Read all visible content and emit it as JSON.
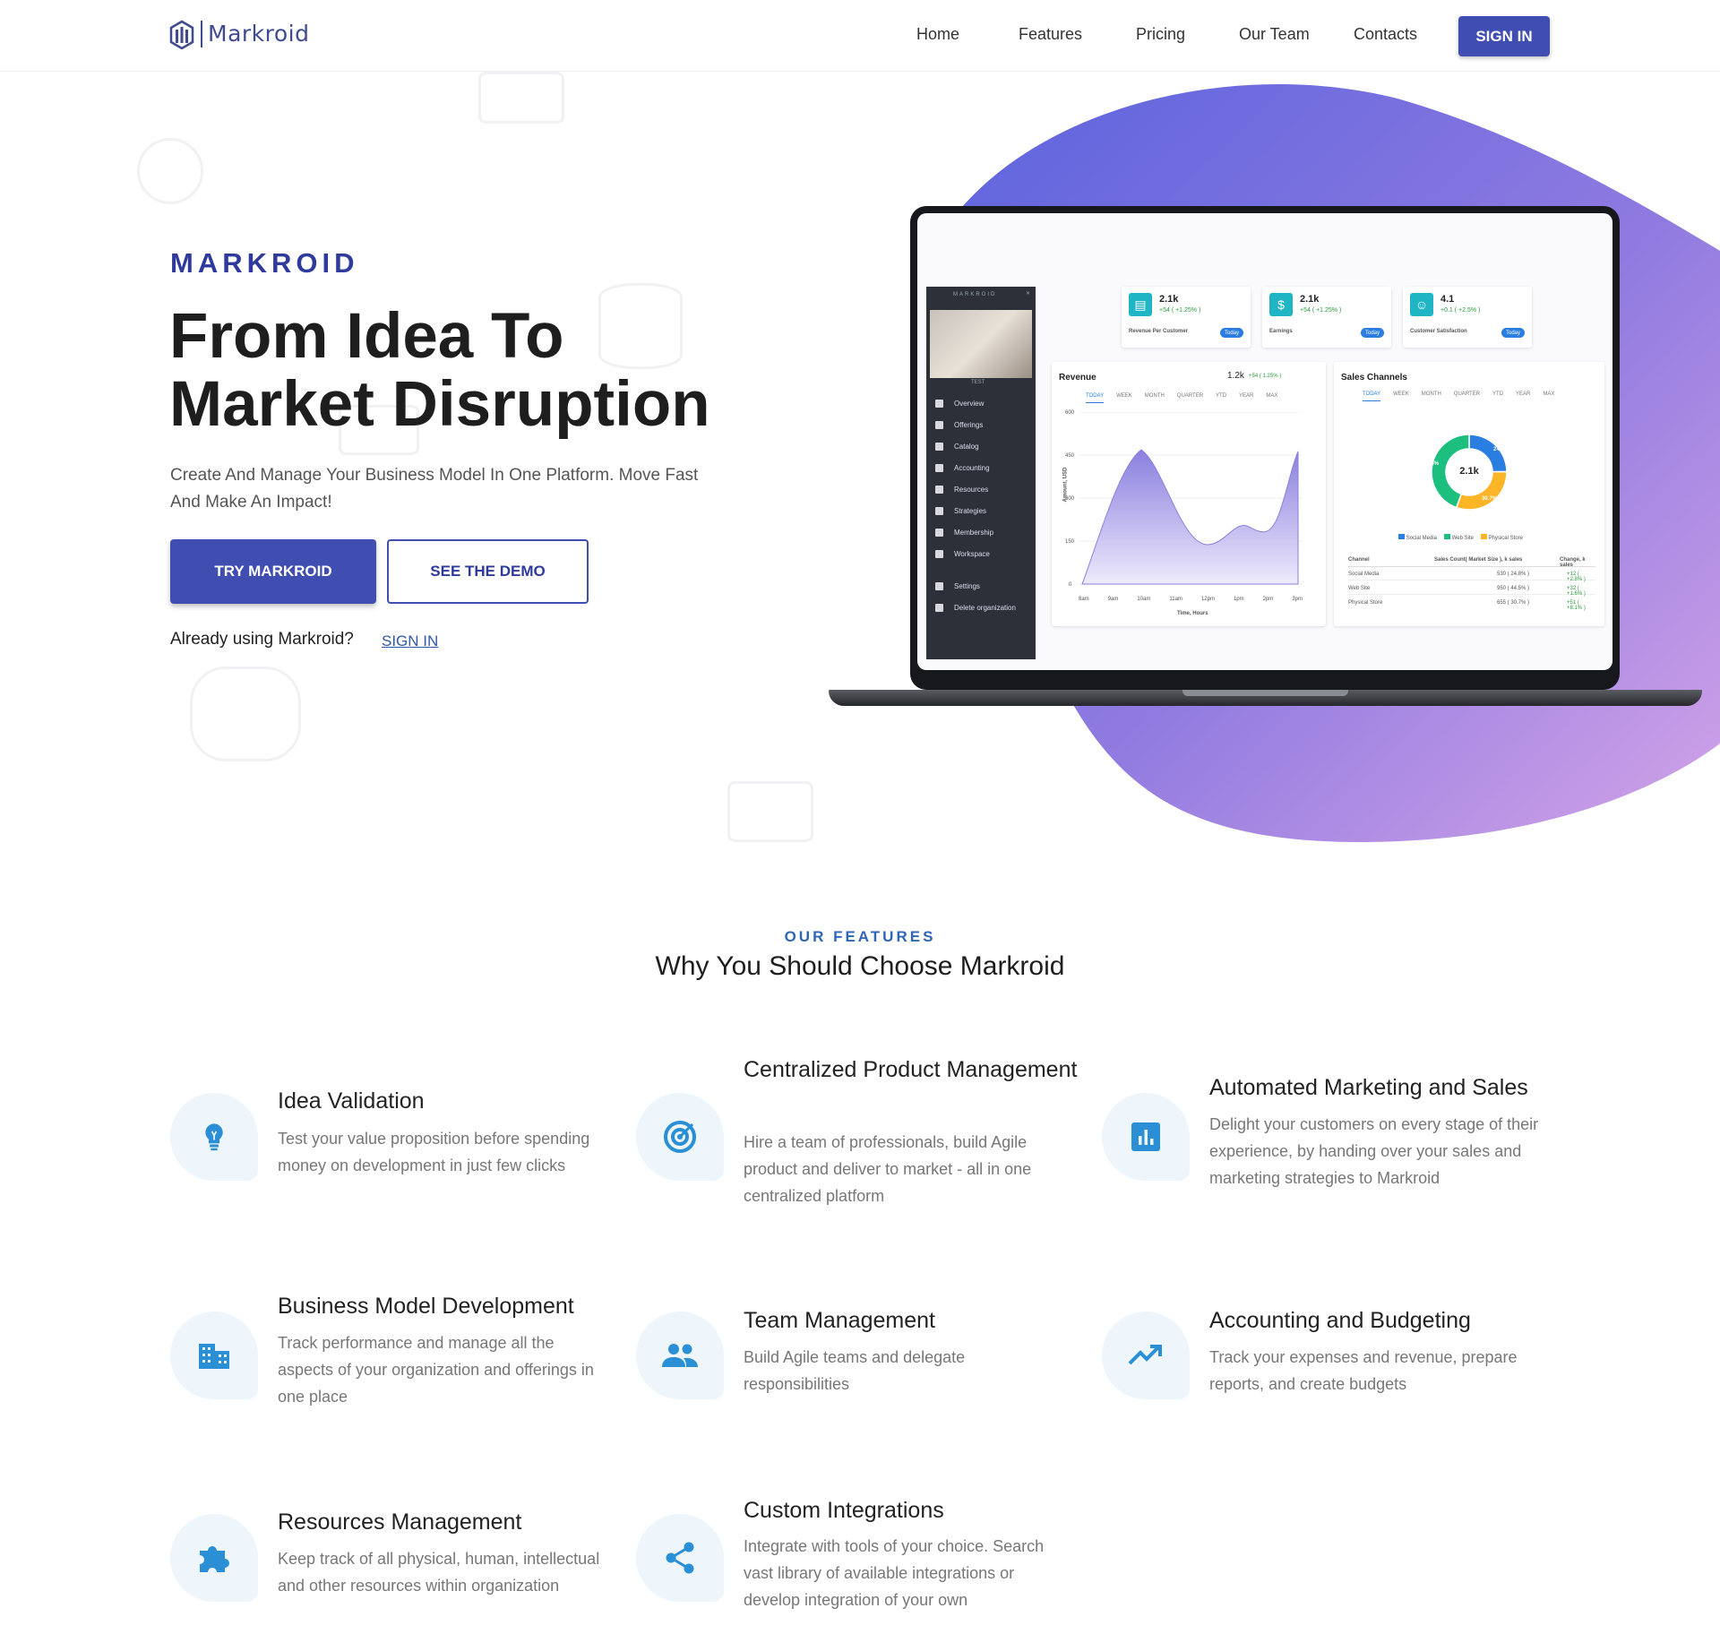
{
  "nav": {
    "logo_text": "Markroid",
    "links": [
      "Home",
      "Features",
      "Pricing",
      "Our Team",
      "Contacts"
    ],
    "signin": "SIGN IN"
  },
  "hero": {
    "brand": "MARKROID",
    "title_line1": "From Idea To",
    "title_line2": "Market Disruption",
    "subtitle": "Create And Manage Your Business Model In One Platform. Move Fast And Make An Impact!",
    "try_button": "TRY MARKROID",
    "demo_button": "SEE THE DEMO",
    "already": "Already using Markroid?",
    "already_link": "SIGN IN"
  },
  "dashboard": {
    "sidebar_brand": "MARKROID",
    "sidebar_user": "TEST",
    "sidebar_items": [
      "Overview",
      "Offerings",
      "Catalog",
      "Accounting",
      "Resources",
      "Strategies",
      "Membership",
      "Workspace",
      "Settings",
      "Delete organization"
    ],
    "kpis": [
      {
        "value": "2.1k",
        "change": "+54 ( +1.25% )",
        "label": "Revenue Per Customer",
        "pill": "Today"
      },
      {
        "value": "2.1k",
        "change": "+54 ( +1.25% )",
        "label": "Earnings",
        "pill": "Today"
      },
      {
        "value": "4.1",
        "change": "+0.1 ( +2.5% )",
        "label": "Customer Satisfaction",
        "pill": "Today"
      }
    ],
    "revenue": {
      "title": "Revenue",
      "value": "1.2k",
      "change": "+54 ( 1.25% )",
      "tabs": [
        "TODAY",
        "WEEK",
        "MONTH",
        "QUARTER",
        "YTD",
        "YEAR",
        "MAX"
      ],
      "ylabel": "Amount, USD",
      "xlabel": "Time, Hours",
      "yticks": [
        "600",
        "450",
        "300",
        "150",
        "0"
      ],
      "xticks": [
        "8am",
        "9am",
        "10am",
        "11am",
        "12pm",
        "1pm",
        "2pm",
        "3pm"
      ]
    },
    "sales": {
      "title": "Sales Channels",
      "tabs": [
        "TODAY",
        "WEEK",
        "MONTH",
        "QUARTER",
        "YTD",
        "YEAR",
        "MAX"
      ],
      "center": "2.1k",
      "slices": [
        {
          "name": "Social Media",
          "pct": "24.8%",
          "value": 24.8,
          "color": "#2a7de1"
        },
        {
          "name": "Web Site",
          "pct": "44.5%",
          "value": 44.5,
          "color": "#1cbf7d"
        },
        {
          "name": "Physical Store",
          "pct": "30.7%",
          "value": 30.7,
          "color": "#fbb526"
        }
      ],
      "table_headers": [
        "Channel",
        "Sales Count( Market Size ), k sales",
        "Change, k sales"
      ],
      "rows": [
        [
          "Social Media",
          "530 ( 24.8% )",
          "+12 ( +2.8% )"
        ],
        [
          "Web Site",
          "950 ( 44.5% )",
          "+32 ( +1.6% )"
        ],
        [
          "Physical Store",
          "655 ( 30.7% )",
          "+51 ( +8.1% )"
        ]
      ]
    }
  },
  "features": {
    "kicker": "OUR FEATURES",
    "title": "Why You Should Choose Markroid",
    "items": [
      {
        "title": "Idea Validation",
        "desc": "Test your value proposition before spending money on development in just few clicks",
        "icon": "lightbulb-icon"
      },
      {
        "title": "Centralized Product Management",
        "desc": "Hire a team of professionals, build Agile product and deliver to market - all in one centralized platform",
        "icon": "target-icon"
      },
      {
        "title": "Automated Marketing and Sales",
        "desc": "Delight your customers on every stage of their experience, by handing over your sales and marketing strategies to Markroid",
        "icon": "bar-chart-icon"
      },
      {
        "title": "Business Model Development",
        "desc": "Track performance and manage all the aspects of your organization and offerings in one place",
        "icon": "building-icon"
      },
      {
        "title": "Team Management",
        "desc": "Build Agile teams and delegate responsibilities",
        "icon": "people-icon"
      },
      {
        "title": "Accounting and Budgeting",
        "desc": "Track your expenses and revenue, prepare reports, and create budgets",
        "icon": "trending-up-icon"
      },
      {
        "title": "Resources Management",
        "desc": "Keep track of all physical, human, intellectual and other resources within organization",
        "icon": "puzzle-icon"
      },
      {
        "title": "Custom Integrations",
        "desc": "Integrate with tools of your choice. Search vast library of available integrations or develop integration of your own",
        "icon": "share-icon"
      }
    ]
  },
  "colors": {
    "primary": "#3f4eb0",
    "accent": "#2b8fd6",
    "blob_start": "#5b63de",
    "blob_end": "#c59be6"
  }
}
